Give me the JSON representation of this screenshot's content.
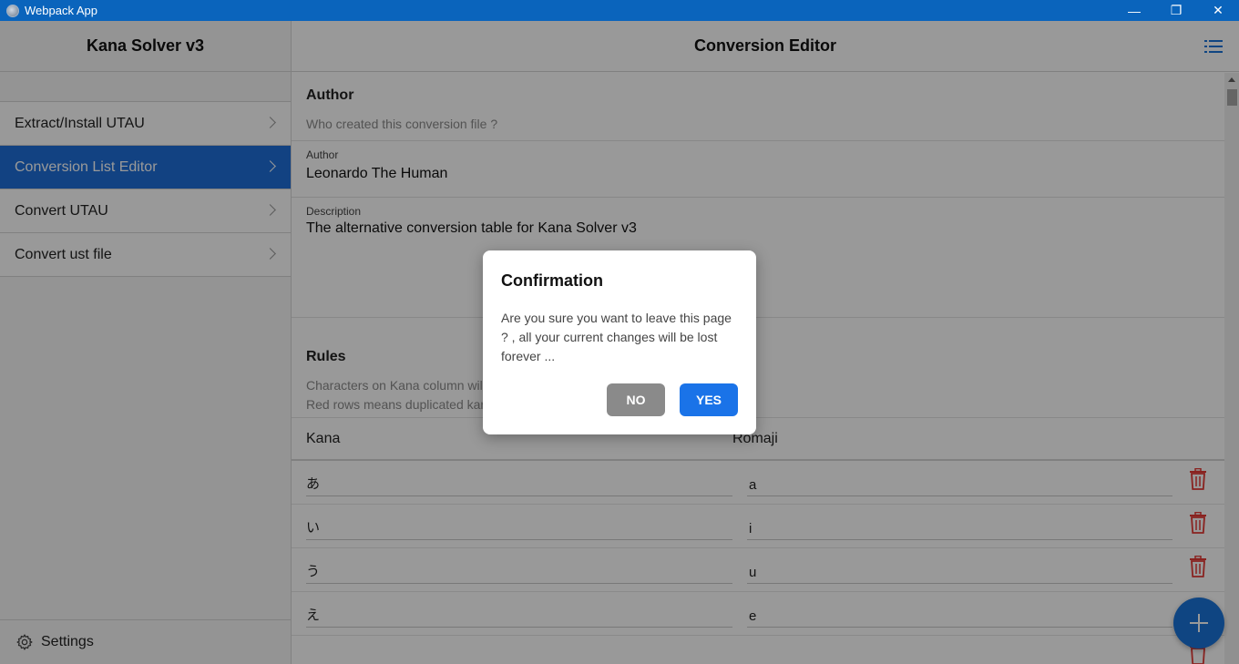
{
  "window": {
    "title": "Webpack App",
    "controls": [
      "—",
      "❐",
      "✕"
    ]
  },
  "sidebar": {
    "title": "Kana Solver v3",
    "items": [
      {
        "label": "Extract/Install UTAU"
      },
      {
        "label": "Conversion List Editor",
        "active": true
      },
      {
        "label": "Convert UTAU"
      },
      {
        "label": "Convert ust file"
      }
    ],
    "footer_label": "Settings"
  },
  "main": {
    "title": "Conversion Editor",
    "author_section": {
      "title": "Author",
      "description": "Who created this conversion file ?",
      "author_label": "Author",
      "author_value": "Leonardo The Human",
      "description_label": "Description",
      "description_value": "The alternative conversion table for Kana Solver v3"
    },
    "rules_section": {
      "title": "Rules",
      "description_line1": "Characters on Kana column will",
      "description_line2": "Red rows means duplicated kan"
    },
    "table": {
      "headers": [
        "Kana",
        "Romaji"
      ],
      "rows": [
        {
          "kana": "あ",
          "romaji": "a"
        },
        {
          "kana": "い",
          "romaji": "i"
        },
        {
          "kana": "う",
          "romaji": "u"
        },
        {
          "kana": "え",
          "romaji": "e"
        }
      ]
    }
  },
  "modal": {
    "title": "Confirmation",
    "body": "Are you sure you want to leave this page ? , all your current changes will be lost forever ...",
    "no_label": "NO",
    "yes_label": "YES"
  },
  "colors": {
    "titlebar": "#0a64bc",
    "accent": "#1e6fd9",
    "danger": "#e53935",
    "fab": "#1a73d9"
  }
}
